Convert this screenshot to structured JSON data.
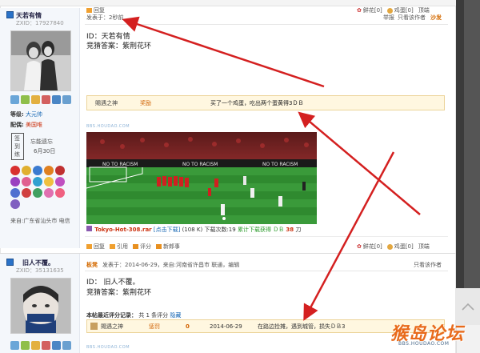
{
  "post1": {
    "username": "天若有情",
    "uid": "ZXID：17927840",
    "posted": "发表于：2秒前",
    "report": "举报",
    "only_author": "只看该作者",
    "floor": "沙发",
    "body_line1": "ID：天若有情",
    "body_line2": "竞猜答案：紫荆花环",
    "level_label": "等级:",
    "level_value": "大元帅",
    "spouse_label": "配偶:",
    "spouse_value": "美国唯",
    "sign_label": "签",
    "sign_label2": "到",
    "sign_label3": "练",
    "sign_text": "忘能遗忘",
    "sign_date": "6月30日",
    "location": "来自:广东省汕头市 电信",
    "reward": {
      "name": "賜遇之神",
      "type": "奖励",
      "message": "买了一个鸡蛋，吃出两个蛋黄得3ＤＢ"
    },
    "watermark": "BBS.HOUDAO.COM",
    "attachment_name": "Tokyo-Hot-308.rar",
    "attachment_link": "[点击下载]",
    "attachment_size": "(108 K)",
    "attachment_downloads": "下载次数:19",
    "attachment_earned": "累计下载获得",
    "attachment_db": "ＤＢ",
    "attachment_cost": "38",
    "attachment_unit": "刀",
    "actions": [
      "回复",
      "引用",
      "评分",
      "新郎事"
    ],
    "flower": "鲜花[0]",
    "egg": "鸡蛋[0]",
    "top": "顶端",
    "top_actions_flower": "鲜花[0]",
    "top_actions_egg": "鸡蛋[0]",
    "top_actions_top": "顶端",
    "top_actions_reply": "回复"
  },
  "post2": {
    "username": "旧人不覆。",
    "uid": "ZXID：35131635",
    "floor": "板凳",
    "posted": "发表于：2014-06-29，来自:河南省许昌市 联通，编辑",
    "only_author": "只看该作者",
    "body_line1": "ID：  旧人不覆。",
    "body_line2": "竞猜答案：紫荆花环",
    "rate_title": "本帖最近评分记录：",
    "rate_count": "共 1 条评分",
    "rate_hide": "隐藏",
    "rate": {
      "name": "賜遇之神",
      "type": "惩罚",
      "value": "0",
      "date": "2014-06-29",
      "message": "在路边捡摊，遇到城管，损失ＤＢ3"
    },
    "watermark": "BBS.HOUDAO.COM"
  },
  "site_logo": "猴岛论坛",
  "site_url": "BBS.HOUDAO.COM",
  "colors": {
    "link": "#1566b3",
    "floor": "#d46a00",
    "arrow": "#d42020",
    "reward_bg": "#fff7e0"
  }
}
